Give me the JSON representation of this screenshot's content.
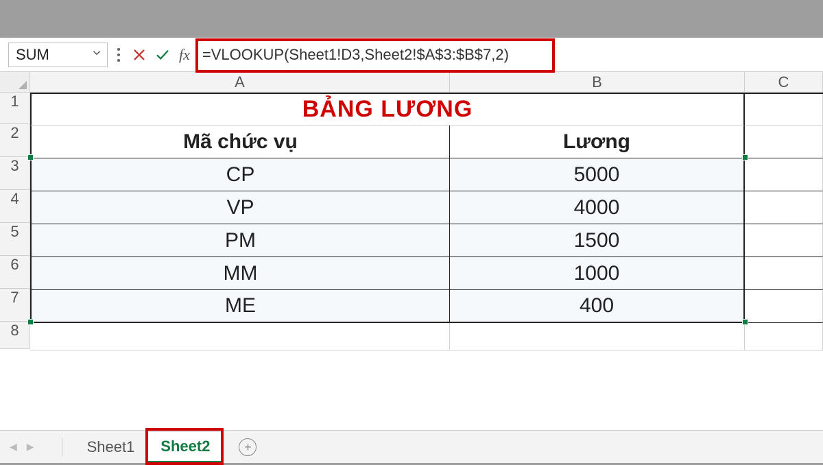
{
  "nameBox": {
    "value": "SUM"
  },
  "formulaBar": {
    "formula": "=VLOOKUP(Sheet1!D3,Sheet2!$A$3:$B$7,2)"
  },
  "columns": {
    "A": "A",
    "B": "B",
    "C": "C"
  },
  "rows": [
    "1",
    "2",
    "3",
    "4",
    "5",
    "6",
    "7",
    "8"
  ],
  "title": "BẢNG LƯƠNG",
  "headers": {
    "code": "Mã chức vụ",
    "salary": "Lương"
  },
  "data": [
    {
      "code": "CP",
      "salary": "5000"
    },
    {
      "code": "VP",
      "salary": "4000"
    },
    {
      "code": "PM",
      "salary": "1500"
    },
    {
      "code": "MM",
      "salary": "1000"
    },
    {
      "code": "ME",
      "salary": "400"
    }
  ],
  "tabs": {
    "sheet1": "Sheet1",
    "sheet2": "Sheet2"
  }
}
